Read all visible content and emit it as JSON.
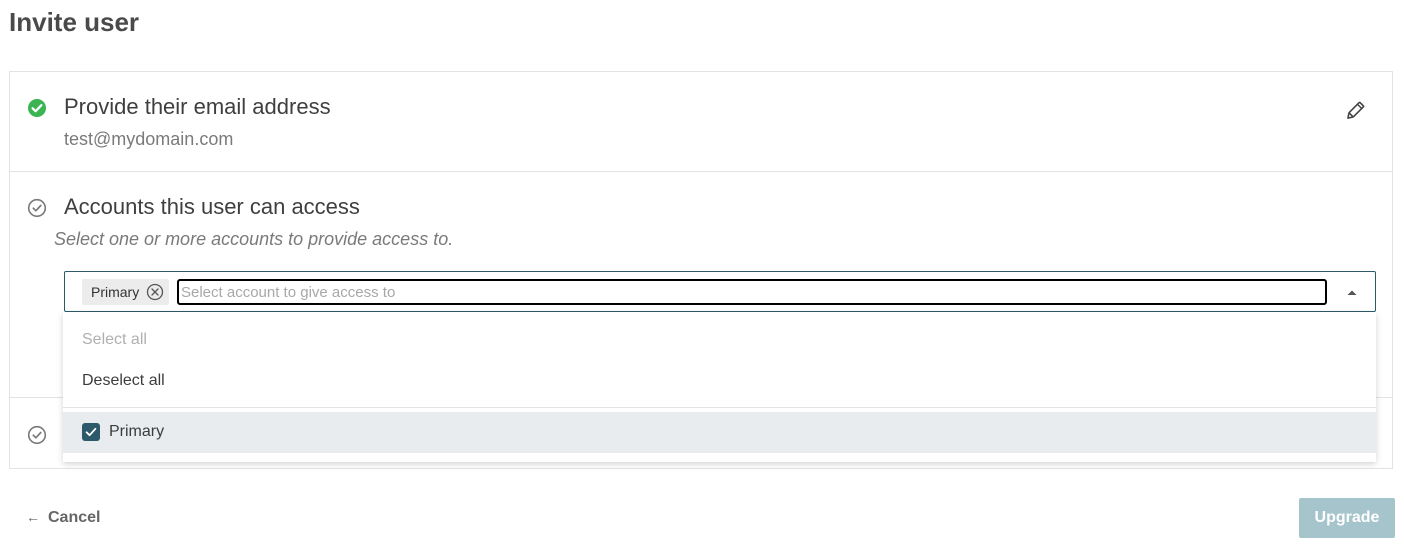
{
  "page": {
    "title": "Invite user"
  },
  "steps": {
    "email": {
      "title": "Provide their email address",
      "value": "test@mydomain.com",
      "status": "complete",
      "edit_icon": "pencil-icon"
    },
    "accounts": {
      "title": "Accounts this user can access",
      "subtitle": "Select one or more accounts to provide access to.",
      "status": "pending",
      "select": {
        "chips": [
          {
            "label": "Primary",
            "remove_icon": "close-circle-icon"
          }
        ],
        "placeholder": "Select account to give access to",
        "toggle_icon": "caret-up-icon",
        "expanded": true
      },
      "dropdown": {
        "select_all": "Select all",
        "deselect_all": "Deselect all",
        "options": [
          {
            "label": "Primary",
            "checked": true
          }
        ]
      }
    },
    "third": {
      "status": "pending"
    }
  },
  "footer": {
    "cancel_label": "Cancel",
    "cancel_arrow": "←",
    "upgrade_label": "Upgrade"
  },
  "colors": {
    "complete_green": "#3db454",
    "accent_teal": "#2d5a6b",
    "button_disabled": "#a6c4cc",
    "selected_row": "#e8ecee"
  }
}
